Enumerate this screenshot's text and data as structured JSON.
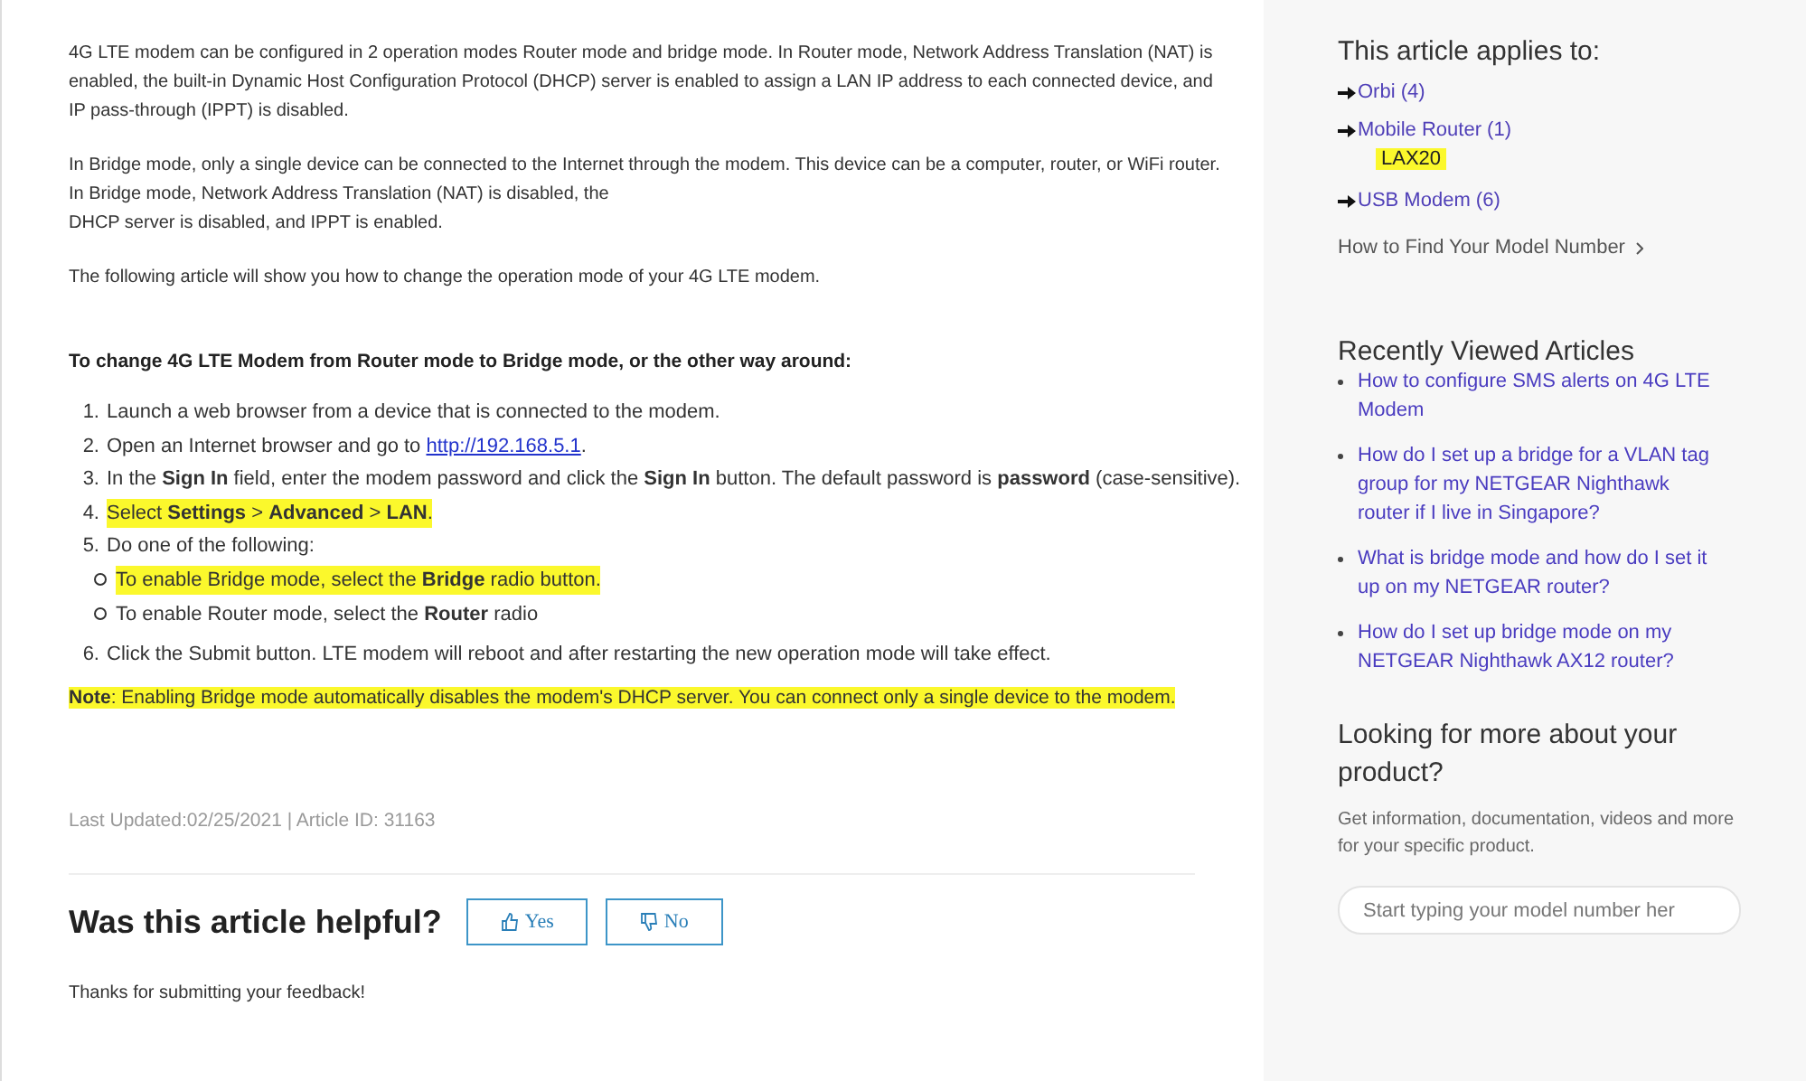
{
  "article": {
    "paragraphs": [
      [
        "4G LTE modem can be configured in 2 operation modes Router mode and bridge mode. In Router mode, Network Address Translation (NAT) is",
        "enabled, the built-in Dynamic Host Configuration Protocol (DHCP) server is enabled to assign a LAN IP address to each connected device, and",
        "IP pass-through (IPPT) is disabled."
      ],
      [
        "In Bridge mode, only a single device can be connected to the Internet through the modem. This device can be a computer, router, or WiFi router.",
        "In Bridge mode, Network Address Translation (NAT) is disabled, the",
        "DHCP server is disabled, and IPPT is enabled."
      ],
      [
        "The following article will show you how to change the operation mode of your 4G LTE modem."
      ]
    ],
    "procedure_heading": "To change 4G LTE Modem from Router mode to Bridge mode, or the other way around:",
    "steps": [
      {
        "number": "1.",
        "text": "Launch a web browser from a device that is connected to the modem.",
        "highlighted": false
      },
      {
        "number": "2.",
        "text": "Open an Internet browser and go to ",
        "link": "http://192.168.5.1",
        "suffix": ".",
        "highlighted": false
      },
      {
        "number": "3.",
        "text": "In the **Sign In** field, enter the modem password and click the **Sign In** button. The default password is **password** (case-sensitive).",
        "highlighted": false
      },
      {
        "number": "4.",
        "text": "Select **Settings** > **Advanced** > **LAN**.",
        "highlighted": true
      },
      {
        "number": "5.",
        "text": "Do one of the following:",
        "highlighted": false,
        "children": [
          {
            "text": "To enable Bridge mode, select the **Bridge** radio button.",
            "highlighted": true
          },
          {
            "text": "To enable Router mode, select the **Router** radio",
            "highlighted": false
          }
        ]
      },
      {
        "number": "6.",
        "text": "Click the Submit button. LTE modem will reboot and after restarting the new operation mode will take effect.",
        "highlighted": false
      }
    ],
    "note": {
      "text": "**Note**: Enabling Bridge mode automatically disables the modem's DHCP server. You can connect only a single device to the modem.",
      "highlighted": true
    },
    "meta": "Last Updated:02/25/2021 | Article ID: 31163",
    "feedback": {
      "question": "Was this article helpful?",
      "buttons": [
        {
          "label": "Yes",
          "kind": "up"
        },
        {
          "label": "No",
          "kind": "down"
        }
      ],
      "thanks": "Thanks for submitting your feedback!"
    }
  },
  "sidebar": {
    "applies_heading": "This article applies to:",
    "products": [
      {
        "label": "Orbi (4)"
      },
      {
        "label": "Mobile Router (1)",
        "models": [
          {
            "label": "LAX20",
            "highlighted": true
          }
        ]
      },
      {
        "label": "USB Modem (6)"
      }
    ],
    "model_help_link": "How to Find Your Model Number",
    "recent_heading": "Recently Viewed Articles",
    "recent": [
      "How to configure SMS alerts on 4G LTE Modem",
      "How do I set up a bridge for a VLAN tag group for my NETGEAR Nighthawk router if I live in Singapore?",
      "What is bridge mode and how do I set it up on my NETGEAR router?",
      "How do I set up bridge mode on my NETGEAR Nighthawk AX12 router?"
    ],
    "more_heading": "Looking for more about your product?",
    "more_text": "Get information, documentation, videos and more for your specific product.",
    "search": {
      "placeholder": "Start typing your model number her"
    }
  }
}
